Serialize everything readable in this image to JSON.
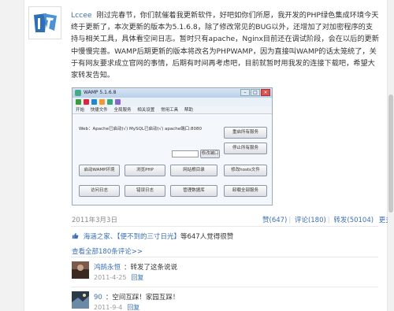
{
  "post": {
    "author": "Lccee",
    "body": "刚过完春节，你们就催着我更新软件，好吧如你们所愿，我开发的PHP绿色集成环境今天终于更新了，本次更新的版本为5.1.6.8，除了修改常见的BUG以外，还增加了对加密程序的支持与相关工具，具体看空间日志。暂时只有apache，Nginx目前还在调试阶段，会在以后的更新中慢慢完善。WAMP后期更新的版本将改名为PHPWAMP，因为直接叫WAMP的话太笼统了，关于有网友要求成立官网的事情，后期有时间再考虑吧，目前就暂时用我发的连接下载吧，希望大家转发告知。",
    "date": "2011年3月3日",
    "actions": {
      "like": "赞(647)",
      "comment": "评论(180)",
      "forward": "转发(50104)",
      "more": "更多"
    },
    "likes_prefix": "海涵之家、",
    "likes_name": "【便不到的三寸日光】",
    "likes_suffix": "等647人觉得很赞",
    "view_all": "查看全部180条评论>>"
  },
  "screenshot": {
    "title": "WAMP 5.1.6.8",
    "menu": [
      "开始",
      "快捷文件",
      "全局服务",
      "相关设置",
      "常用工具",
      "帮助"
    ],
    "status": "Web：Apache已启动(√)    MySQL已启动(√)    apache端口:8080",
    "buttons": {
      "start_all": "重启所有服务",
      "stop_all": "停止所有服务",
      "port": "修改端口",
      "open_root": "启动WAMP环境",
      "phpinfo": "浏览PHP",
      "site_dir": "网站根目录",
      "hosts": "修改hosts文件",
      "access_log": "访问日志",
      "error_log": "错误日志",
      "db": "管理数据库",
      "uninstall": "卸载全部服务"
    }
  },
  "comments": [
    {
      "name": "鸿鹄永恒",
      "text": "：转发了这条说说",
      "date": "2011-4-25",
      "reply": "回复"
    },
    {
      "name": "90",
      "text": "：空间互踩！家园互踩！",
      "date": "2011-9-4",
      "reply": "回复"
    }
  ]
}
